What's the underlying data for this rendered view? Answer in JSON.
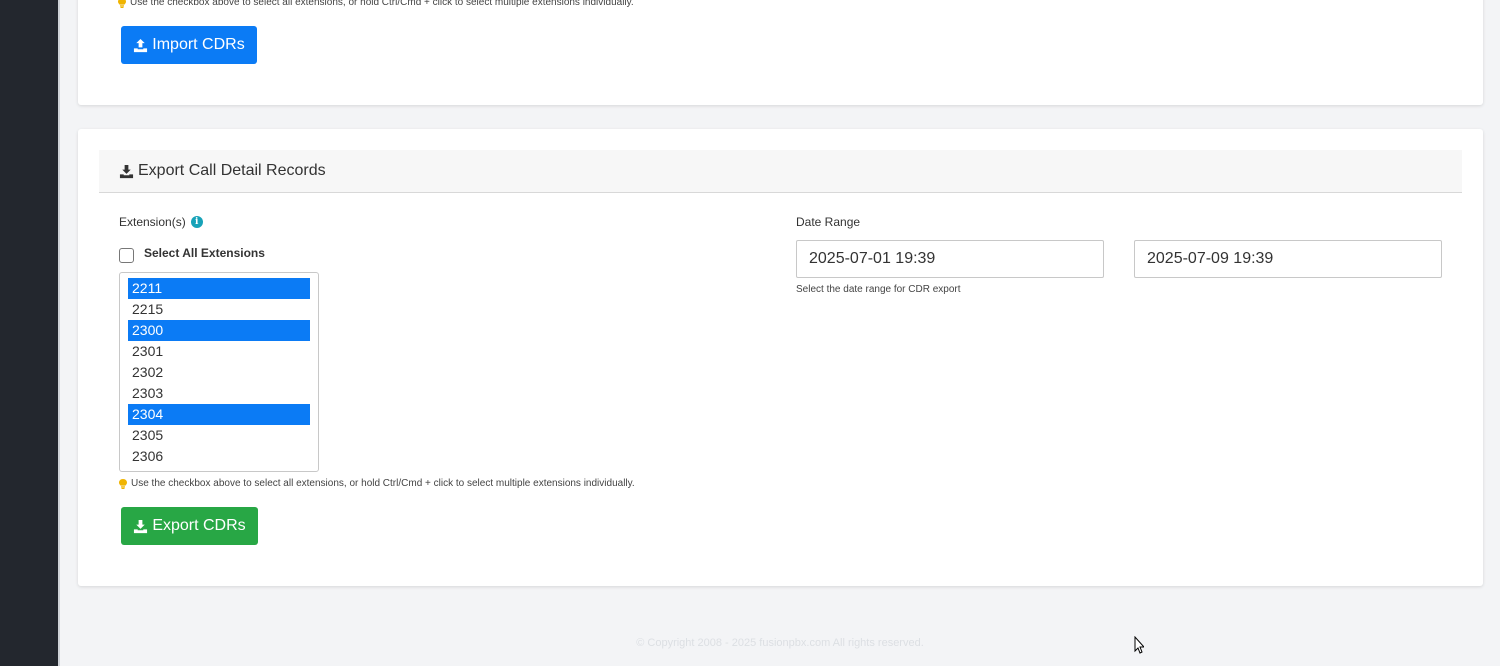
{
  "import_section": {
    "hint": "Use the checkbox above to select all extensions, or hold Ctrl/Cmd + click to select multiple extensions individually.",
    "button_label": "Import CDRs",
    "button_icon": "upload-icon"
  },
  "export_section": {
    "title": "Export Call Detail Records",
    "title_icon": "download-icon",
    "extensions_label": "Extension(s)",
    "select_all_label": "Select All Extensions",
    "select_all_checked": false,
    "extensions": [
      {
        "value": "2211",
        "selected": true
      },
      {
        "value": "2215",
        "selected": false
      },
      {
        "value": "2300",
        "selected": true
      },
      {
        "value": "2301",
        "selected": false
      },
      {
        "value": "2302",
        "selected": false
      },
      {
        "value": "2303",
        "selected": false
      },
      {
        "value": "2304",
        "selected": true
      },
      {
        "value": "2305",
        "selected": false
      },
      {
        "value": "2306",
        "selected": false
      }
    ],
    "hint": "Use the checkbox above to select all extensions, or hold Ctrl/Cmd + click to select multiple extensions individually.",
    "date_range_label": "Date Range",
    "date_start": "2025-07-01 19:39",
    "date_end": "2025-07-09 19:39",
    "date_note": "Select the date range for CDR export",
    "button_label": "Export CDRs",
    "button_icon": "download-icon"
  },
  "footer": {
    "copyright": "© Copyright 2008 - 2025 fusionpbx.com All rights reserved."
  },
  "colors": {
    "primary": "#0b7bf5",
    "success": "#28a745",
    "sidebar": "#23272e",
    "info": "#17a2b8",
    "hint_bulb": "#f0b400"
  }
}
